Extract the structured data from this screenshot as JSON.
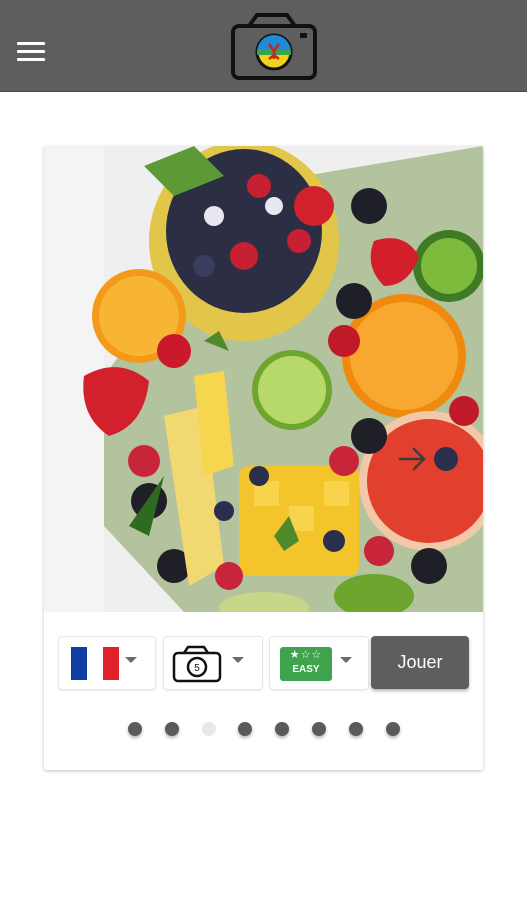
{
  "appbar": {
    "menu_icon": "hamburger-menu-icon",
    "logo_icon": "camera-logo-icon"
  },
  "image": {
    "subject": "fruit-platter-photo",
    "next_icon": "arrow-right-icon"
  },
  "controls": {
    "language": {
      "icon": "france-flag-icon",
      "colors": [
        "#0d3fa3",
        "#ffffff",
        "#e1202b"
      ]
    },
    "photo_source": {
      "icon": "camera-icon"
    },
    "difficulty": {
      "icon": "difficulty-stars-icon",
      "stars": "★☆☆",
      "label": "EASY",
      "color": "#3fa34d"
    },
    "play_label": "Jouer"
  },
  "pagination": {
    "count": 8,
    "active_index": 2
  },
  "colors": {
    "appbar": "#5e5e5e",
    "button": "#5e5e5e",
    "dot": "#5a5a5a",
    "dot_active": "#e8e8e8"
  }
}
